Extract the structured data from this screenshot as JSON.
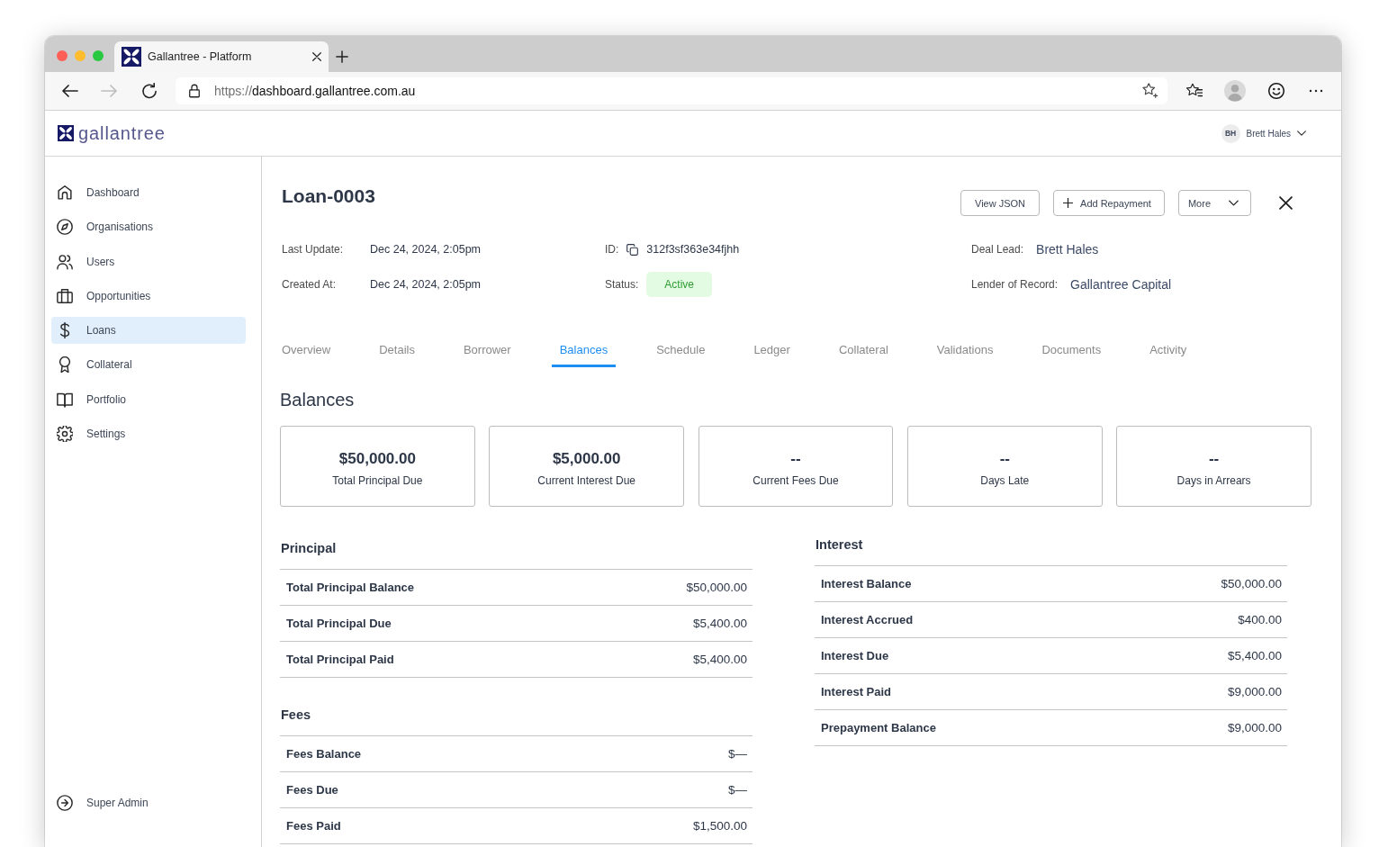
{
  "browser": {
    "tab_title": "Gallantree - Platform",
    "url": {
      "scheme": "https://",
      "host": "dashboard.gallantree.com.au"
    }
  },
  "app_header": {
    "logo_text": "gallantree",
    "user": {
      "initials": "BH",
      "name": "Brett Hales"
    }
  },
  "sidebar": {
    "items": [
      {
        "label": "Dashboard",
        "selected": false
      },
      {
        "label": "Organisations",
        "selected": false
      },
      {
        "label": "Users",
        "selected": false
      },
      {
        "label": "Opportunities",
        "selected": false
      },
      {
        "label": "Loans",
        "selected": true
      },
      {
        "label": "Collateral",
        "selected": false
      },
      {
        "label": "Portfolio",
        "selected": false
      },
      {
        "label": "Settings",
        "selected": false
      }
    ],
    "footer_item": {
      "label": "Super Admin"
    }
  },
  "loan": {
    "title": "Loan-0003",
    "actions": [
      {
        "kind": "plain",
        "label": "View JSON"
      },
      {
        "kind": "add",
        "label": "Add Repayment"
      },
      {
        "kind": "menu",
        "label": "More"
      }
    ],
    "meta_columns": [
      {
        "fields": [
          {
            "kind": "text",
            "label": "Last Update:",
            "value": "Dec 24, 2024, 2:05pm"
          },
          {
            "kind": "text",
            "label": "Created At:",
            "value": "Dec 24, 2024, 2:05pm"
          }
        ]
      },
      {
        "fields": [
          {
            "kind": "copy",
            "label": "ID:",
            "value": "312f3sf363e34fjhh"
          },
          {
            "kind": "badge",
            "label": "Status:",
            "value": "Active"
          }
        ]
      },
      {
        "fields": [
          {
            "kind": "text",
            "label": "Deal Lead:",
            "value": "Brett Hales"
          },
          {
            "kind": "text",
            "label": "Lender of Record:",
            "value": "Gallantree Capital"
          }
        ]
      }
    ]
  },
  "tabs": [
    {
      "label": "Overview",
      "selected": false
    },
    {
      "label": "Details",
      "selected": false
    },
    {
      "label": "Borrower",
      "selected": false
    },
    {
      "label": "Balances",
      "selected": true
    },
    {
      "label": "Schedule",
      "selected": false
    },
    {
      "label": "Ledger",
      "selected": false
    },
    {
      "label": "Collateral",
      "selected": false
    },
    {
      "label": "Validations",
      "selected": false
    },
    {
      "label": "Documents",
      "selected": false
    },
    {
      "label": "Activity",
      "selected": false
    }
  ],
  "section_title": "Balances",
  "summary_cards": [
    {
      "value": "$50,000.00",
      "label": "Total Principal Due"
    },
    {
      "value": "$5,000.00",
      "label": "Current Interest Due"
    },
    {
      "value": "--",
      "label": "Current Fees Due"
    },
    {
      "value": "--",
      "label": "Days Late"
    },
    {
      "value": "--",
      "label": "Days in Arrears"
    }
  ],
  "balance_tables": {
    "left": [
      {
        "title": "Principal",
        "rows": [
          {
            "label": "Total Principal Balance",
            "value": "$50,000.00"
          },
          {
            "label": "Total Principal Due",
            "value": "$5,400.00"
          },
          {
            "label": "Total Principal Paid",
            "value": "$5,400.00"
          }
        ]
      },
      {
        "title": "Fees",
        "rows": [
          {
            "label": "Fees Balance",
            "value": "$—"
          },
          {
            "label": "Fees Due",
            "value": "$—"
          },
          {
            "label": "Fees Paid",
            "value": "$1,500.00"
          }
        ]
      }
    ],
    "right": [
      {
        "title": "Interest",
        "rows": [
          {
            "label": "Interest Balance",
            "value": "$50,000.00"
          },
          {
            "label": "Interest Accrued",
            "value": "$400.00"
          },
          {
            "label": "Interest Due",
            "value": "$5,400.00"
          },
          {
            "label": "Interest Paid",
            "value": "$9,000.00"
          },
          {
            "label": "Prepayment Balance",
            "value": "$9,000.00"
          }
        ]
      }
    ]
  }
}
